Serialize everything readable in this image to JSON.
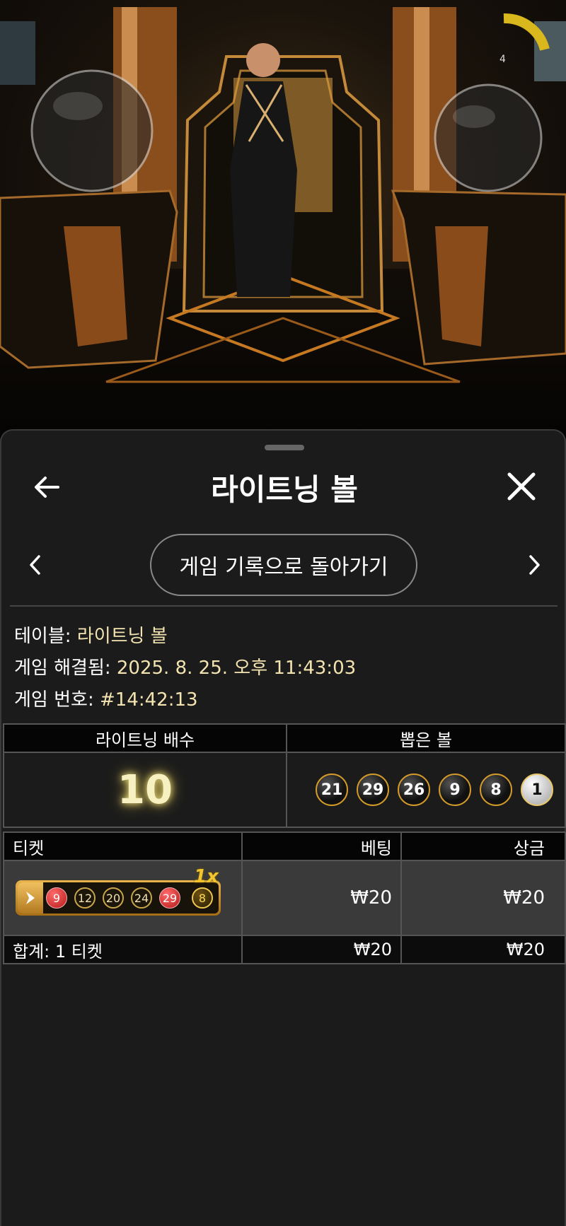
{
  "stage": {
    "round_counter": "4"
  },
  "sheet": {
    "title": "라이트닝 볼",
    "history_button": "게임 기록으로 돌아가기"
  },
  "info": {
    "table_label": "테이블:",
    "table_value": "라이트닝 볼",
    "resolved_label": "게임 해결됨:",
    "resolved_value": "2025. 8. 25. 오후 11:43:03",
    "game_no_label": "게임 번호:",
    "game_no_value": "#14:42:13"
  },
  "result": {
    "multiplier_header": "라이트닝 배수",
    "drawn_header": "뽑은 볼",
    "multiplier": "10",
    "balls": [
      "21",
      "29",
      "26",
      "9",
      "8",
      "1"
    ]
  },
  "tickets": {
    "headers": {
      "ticket": "티켓",
      "bet": "베팅",
      "prize": "상금"
    },
    "rows": [
      {
        "numbers": [
          "9",
          "12",
          "20",
          "24",
          "29"
        ],
        "extra": "8",
        "badge": "1x",
        "bet": "₩20",
        "prize": "₩20"
      }
    ],
    "total": {
      "label": "합계: 1 티켓",
      "bet": "₩20",
      "prize": "₩20"
    }
  },
  "colors": {
    "accent_gold": "#f3e3b0",
    "ball_ring": "#d49a2a",
    "red_ball": "#c62828"
  }
}
